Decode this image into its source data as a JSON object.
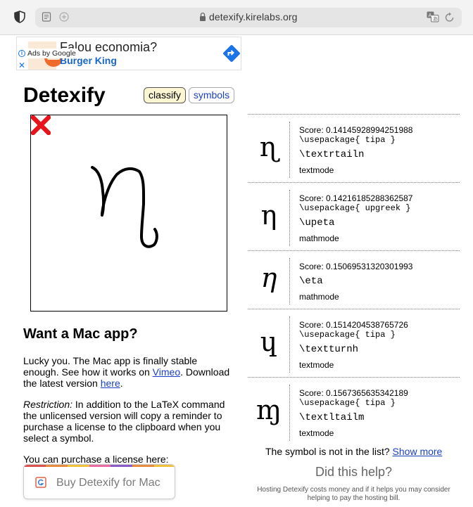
{
  "browser": {
    "url": "detexify.kirelabs.org"
  },
  "ad": {
    "headline": "Falou economia?",
    "advertiser": "Burger King",
    "ads_by": "Ads by Google"
  },
  "header": {
    "title": "Detexify",
    "classify_label": "classify",
    "symbols_label": "symbols"
  },
  "mac_app": {
    "heading": "Want a Mac app?",
    "p1_text": "Lucky you. The Mac app is finally stable enough. See how it works on ",
    "p1_link_vimeo": "Vimeo",
    "p1_mid": ". Download the latest version ",
    "p1_link_here": "here",
    "p1_end": ".",
    "p2_label": "Restriction:",
    "p2_text": " In addition to the LaTeX command the unlicensed version will copy a reminder to purchase a license to the clipboard when you select a symbol.",
    "p3_text": "You can purchase a license here:",
    "buy_label": "Buy Detexify for Mac"
  },
  "results": [
    {
      "glyph": "ɳ",
      "italic": false,
      "score": "Score: 0.14145928994251988",
      "package": "\\usepackage{ tipa }",
      "command": "\\textrtailn",
      "mode": "textmode"
    },
    {
      "glyph": "η",
      "italic": false,
      "score": "Score: 0.14216185288362587",
      "package": "\\usepackage{ upgreek }",
      "command": "\\upeta",
      "mode": "mathmode"
    },
    {
      "glyph": "η",
      "italic": true,
      "score": "Score: 0.15069531320301993",
      "package": "",
      "command": "\\eta",
      "mode": "mathmode"
    },
    {
      "glyph": "ɥ",
      "italic": false,
      "score": "Score: 0.1514204538765726",
      "package": "\\usepackage{ tipa }",
      "command": "\\textturnh",
      "mode": "textmode"
    },
    {
      "glyph": "ɱ",
      "italic": false,
      "score": "Score: 0.1567365635342189",
      "package": "\\usepackage{ tipa }",
      "command": "\\textltailm",
      "mode": "textmode"
    }
  ],
  "footer": {
    "not_in_list": "The symbol is not in the list? ",
    "show_more": "Show more",
    "did_this_help": "Did this help?",
    "hosting": "Hosting Detexify costs money and if it helps you may consider helping to pay the hosting bill."
  },
  "colors": {
    "link": "#1a3fc2",
    "classify_bg": "#fcf6d3",
    "clear_red": "#e8141b",
    "ad_blue": "#1a73e8"
  }
}
